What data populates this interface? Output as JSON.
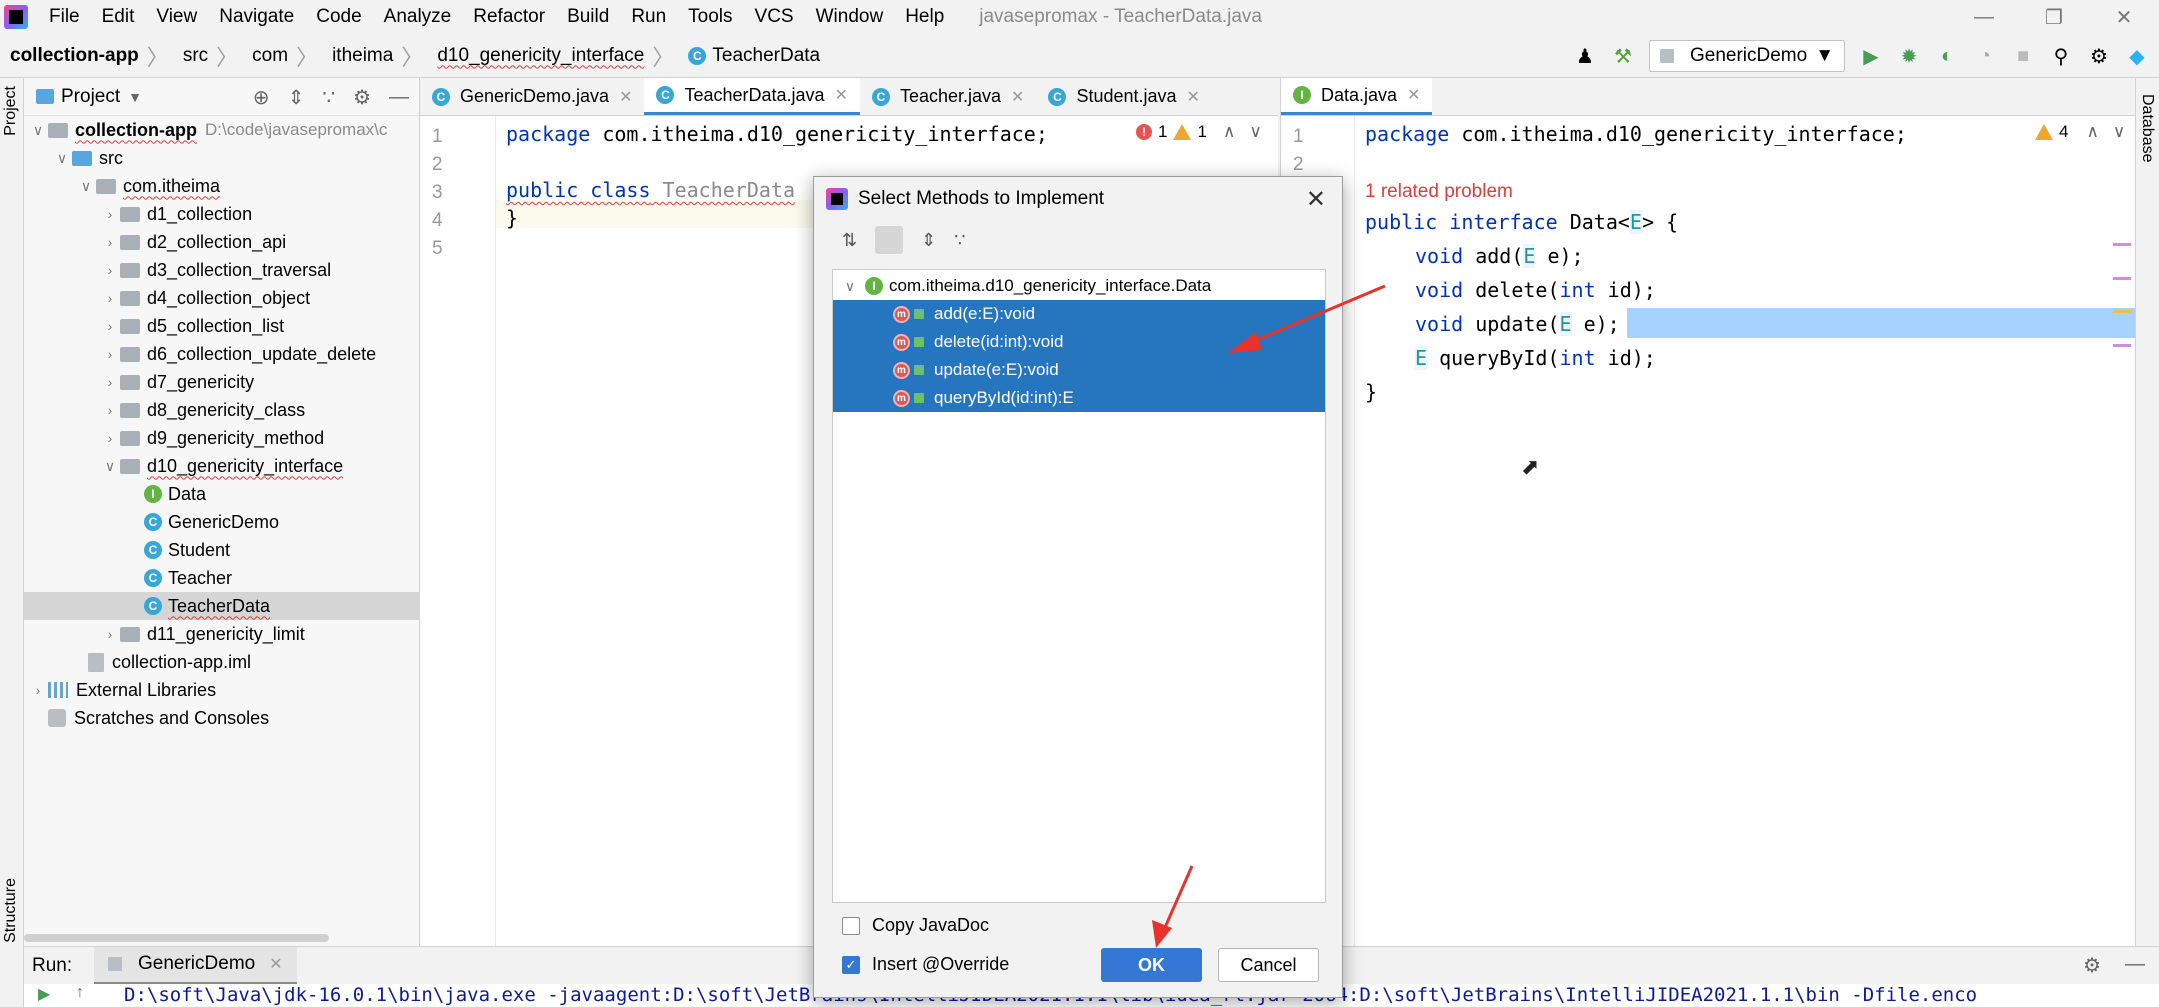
{
  "menubar": {
    "items": [
      "File",
      "Edit",
      "View",
      "Navigate",
      "Code",
      "Analyze",
      "Refactor",
      "Build",
      "Run",
      "Tools",
      "VCS",
      "Window",
      "Help"
    ],
    "window_title": "javasepromax - TeacherData.java"
  },
  "navbar": {
    "crumbs": [
      "collection-app",
      "src",
      "com",
      "itheima",
      "d10_genericity_interface",
      "TeacherData"
    ],
    "run_config": "GenericDemo"
  },
  "project_panel": {
    "title": "Project",
    "root_label": "collection-app",
    "root_path": "D:\\code\\javasepromax\\c",
    "src": "src",
    "package": "com.itheima",
    "folders": [
      "d1_collection",
      "d2_collection_api",
      "d3_collection_traversal",
      "d4_collection_object",
      "d5_collection_list",
      "d6_collection_update_delete",
      "d7_genericity",
      "d8_genericity_class",
      "d9_genericity_method"
    ],
    "open_folder": "d10_genericity_interface",
    "files": [
      {
        "name": "Data",
        "kind": "I"
      },
      {
        "name": "GenericDemo",
        "kind": "C"
      },
      {
        "name": "Student",
        "kind": "C"
      },
      {
        "name": "Teacher",
        "kind": "C"
      },
      {
        "name": "TeacherData",
        "kind": "C"
      }
    ],
    "last_folder": "d11_genericity_limit",
    "iml": "collection-app.iml",
    "external_libraries": "External Libraries",
    "scratches": "Scratches and Consoles"
  },
  "left_stripe": {
    "project": "Project",
    "structure": "Structure"
  },
  "right_stripe": {
    "database": "Database"
  },
  "editor_left": {
    "tabs": [
      "GenericDemo.java",
      "TeacherData.java",
      "Teacher.java",
      "Student.java"
    ],
    "line_numbers": [
      "1",
      "2",
      "3",
      "4",
      "5"
    ],
    "line1_kw": "package",
    "line1_rest": " com.itheima.d10_genericity_interface;",
    "line3_kw": "public class",
    "line3_rest": " TeacherData",
    "line4": "}",
    "error_count": "1",
    "warning_count": "1"
  },
  "editor_right": {
    "tabs": [
      "Data.java"
    ],
    "line_numbers": [
      "1",
      "2"
    ],
    "line1_kw": "package",
    "line1_rest": " com.itheima.d10_genericity_interface;",
    "warning_count": "4",
    "related_problem": "1 related problem",
    "decl_kw": "public interface",
    "decl_name": " Data<",
    "decl_tp": "E",
    "decl_end": "> {",
    "m1_kw": "void",
    "m1_name": " add(",
    "m1_tp": "E",
    "m1_end": " e);",
    "m2_kw": "void",
    "m2_name": " delete(",
    "m2_int": "int",
    "m2_end": " id);",
    "m3_kw": "void",
    "m3_name": " update(",
    "m3_tp": "E",
    "m3_end": " e);",
    "m4_tp": "E",
    "m4_name": " queryById(",
    "m4_int": "int",
    "m4_end": " id);",
    "close": "}"
  },
  "dialog": {
    "title": "Select Methods to Implement",
    "interface": "com.itheima.d10_genericity_interface.Data",
    "methods": [
      "add(e:E):void",
      "delete(id:int):void",
      "update(e:E):void",
      "queryById(id:int):E"
    ],
    "copy_javadoc": "Copy JavaDoc",
    "insert_override": "Insert @Override",
    "copy_javadoc_checked": false,
    "insert_override_checked": true,
    "ok": "OK",
    "cancel": "Cancel"
  },
  "runbar": {
    "label": "Run:",
    "tab": "GenericDemo",
    "console": "D:\\soft\\Java\\jdk-16.0.1\\bin\\java.exe -javaagent:D:\\soft\\JetBrains\\IntelliJIDEA2021.1.1\\lib\\idea_rt.jar=2064:D:\\soft\\JetBrains\\IntelliJIDEA2021.1.1\\bin -Dfile.enco"
  },
  "colors": {
    "accent": "#3577d4",
    "selection": "#2675bf",
    "keyword": "#0033b3",
    "annotation_arrow": "#e8322b"
  }
}
